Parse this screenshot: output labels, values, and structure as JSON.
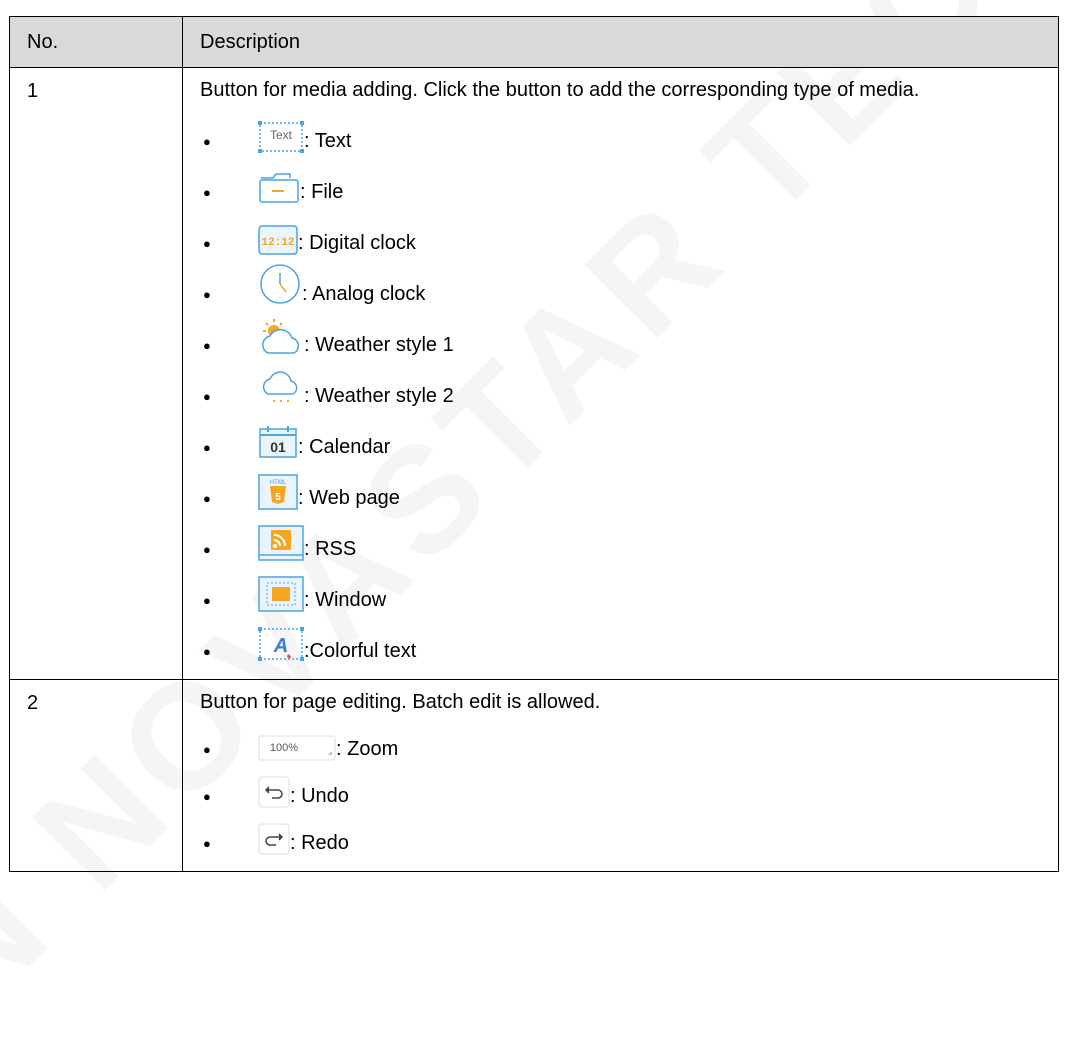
{
  "watermark": "N NOVASTAR TECH",
  "table": {
    "headers": [
      "No.",
      "Description"
    ],
    "rows": [
      {
        "no": "1",
        "intro": "Button for media adding. Click the button to add the corresponding type of media.",
        "items": [
          {
            "icon": "text-media-icon",
            "icon_text": "Text",
            "label": ": Text"
          },
          {
            "icon": "folder-icon",
            "label": ": File"
          },
          {
            "icon": "digital-clock-icon",
            "icon_text": "12:12",
            "label": ": Digital clock"
          },
          {
            "icon": "analog-clock-icon",
            "label": ": Analog clock"
          },
          {
            "icon": "sun-cloud-icon",
            "label": ": Weather style 1"
          },
          {
            "icon": "cloud-rain-icon",
            "label": ": Weather style 2"
          },
          {
            "icon": "calendar-icon",
            "icon_text": "01",
            "label": ": Calendar"
          },
          {
            "icon": "html5-icon",
            "icon_text": "HTML",
            "label": ": Web page"
          },
          {
            "icon": "rss-icon",
            "label": ": RSS"
          },
          {
            "icon": "window-icon",
            "label": ": Window"
          },
          {
            "icon": "colorful-text-icon",
            "icon_text": "A",
            "label": ":Colorful text"
          }
        ]
      },
      {
        "no": "2",
        "intro": "Button for page editing. Batch edit is allowed.",
        "items": [
          {
            "icon": "zoom-select-icon",
            "icon_text": "100%",
            "label": ": Zoom"
          },
          {
            "icon": "undo-icon",
            "label": ": Undo"
          },
          {
            "icon": "redo-icon",
            "label": ": Redo"
          }
        ]
      }
    ]
  },
  "colors": {
    "accent_blue": "#3a9ad9",
    "accent_orange": "#f5a623",
    "header_bg": "#d9d9d9"
  }
}
